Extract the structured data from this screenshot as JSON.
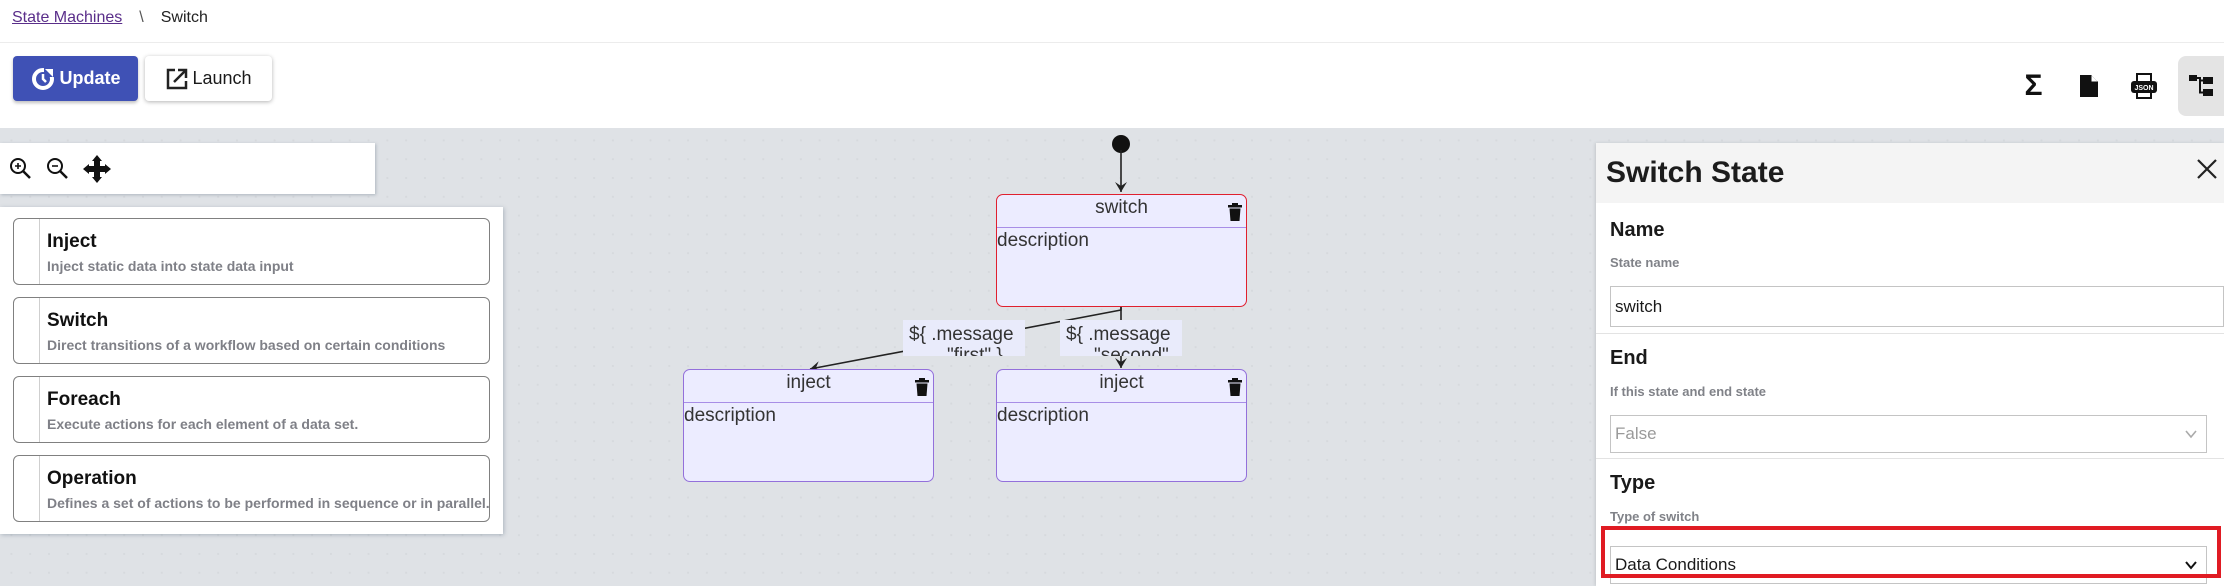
{
  "breadcrumb": {
    "parent": "State Machines",
    "separator": "\\",
    "current": "Switch"
  },
  "toolbar": {
    "update_label": "Update",
    "launch_label": "Launch",
    "update_icon": "refresh-icon",
    "launch_icon": "external-link-icon",
    "right_tools": [
      {
        "name": "sigma-icon",
        "label": "Σ"
      },
      {
        "name": "file-icon"
      },
      {
        "name": "print-json-icon",
        "label": "JSON"
      },
      {
        "name": "tree-diagram-icon",
        "active": true
      }
    ]
  },
  "canvas": {
    "zoom_controls": [
      "zoom-in-icon",
      "zoom-out-icon",
      "move-icon"
    ],
    "palette": [
      {
        "title": "Inject",
        "description": "Inject static data into state data input"
      },
      {
        "title": "Switch",
        "description": "Direct transitions of a workflow based on certain conditions"
      },
      {
        "title": "Foreach",
        "description": "Execute actions for each element of a data set."
      },
      {
        "title": "Operation",
        "description": "Defines a set of actions to be performed in sequence or in parallel."
      }
    ],
    "nodes": [
      {
        "id": "switch",
        "title": "switch",
        "description": "description",
        "selected": true
      },
      {
        "id": "inject-1",
        "title": "inject",
        "description": "description",
        "selected": false
      },
      {
        "id": "inject-2",
        "title": "inject",
        "description": "description",
        "selected": false
      }
    ],
    "edges": [
      {
        "from": "start",
        "to": "switch",
        "label": ""
      },
      {
        "from": "switch",
        "to": "inject-1",
        "label_line1": "${ .message",
        "label_line2": "\"first\" }"
      },
      {
        "from": "switch",
        "to": "inject-2",
        "label_line1": "${ .message",
        "label_line2": "\"second\""
      }
    ]
  },
  "panel": {
    "title": "Switch State",
    "sections": {
      "name": {
        "title": "Name",
        "label": "State name",
        "value": "switch"
      },
      "end": {
        "title": "End",
        "label": "If this state and end state",
        "value": "False"
      },
      "type": {
        "title": "Type",
        "label": "Type of switch",
        "value": "Data Conditions"
      }
    }
  },
  "colors": {
    "primary": "#3f51b5",
    "node_fill": "#ececff",
    "node_border": "#9370db",
    "selected_border": "#e0202e",
    "highlight": "#e01b23"
  }
}
